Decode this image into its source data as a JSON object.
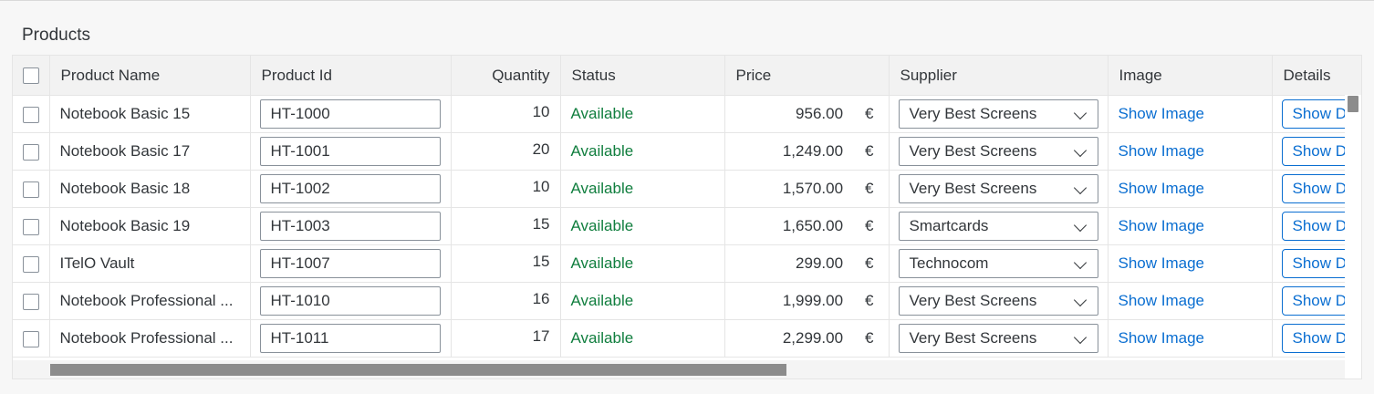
{
  "panel": {
    "title": "Products"
  },
  "columns": {
    "name": "Product Name",
    "id": "Product Id",
    "quantity": "Quantity",
    "status": "Status",
    "price": "Price",
    "supplier": "Supplier",
    "image": "Image",
    "details": "Details"
  },
  "rows": [
    {
      "name": "Notebook Basic 15",
      "id": "HT-1000",
      "quantity": "10",
      "status": "Available",
      "price": "956.00",
      "currency": "€",
      "supplier": "Very Best Screens",
      "image": "Show Image",
      "details": "Show Details"
    },
    {
      "name": "Notebook Basic 17",
      "id": "HT-1001",
      "quantity": "20",
      "status": "Available",
      "price": "1,249.00",
      "currency": "€",
      "supplier": "Very Best Screens",
      "image": "Show Image",
      "details": "Show Details"
    },
    {
      "name": "Notebook Basic 18",
      "id": "HT-1002",
      "quantity": "10",
      "status": "Available",
      "price": "1,570.00",
      "currency": "€",
      "supplier": "Very Best Screens",
      "image": "Show Image",
      "details": "Show Details"
    },
    {
      "name": "Notebook Basic 19",
      "id": "HT-1003",
      "quantity": "15",
      "status": "Available",
      "price": "1,650.00",
      "currency": "€",
      "supplier": "Smartcards",
      "image": "Show Image",
      "details": "Show Details"
    },
    {
      "name": "ITelO Vault",
      "id": "HT-1007",
      "quantity": "15",
      "status": "Available",
      "price": "299.00",
      "currency": "€",
      "supplier": "Technocom",
      "image": "Show Image",
      "details": "Show Details"
    },
    {
      "name": "Notebook Professional ...",
      "id": "HT-1010",
      "quantity": "16",
      "status": "Available",
      "price": "1,999.00",
      "currency": "€",
      "supplier": "Very Best Screens",
      "image": "Show Image",
      "details": "Show Details"
    },
    {
      "name": "Notebook Professional ...",
      "id": "HT-1011",
      "quantity": "17",
      "status": "Available",
      "price": "2,299.00",
      "currency": "€",
      "supplier": "Very Best Screens",
      "image": "Show Image",
      "details": "Show Details"
    }
  ],
  "colors": {
    "status_success": "#107e3e",
    "link": "#0a6ed1"
  },
  "icons": {
    "dropdown": "chevron-down-icon"
  }
}
